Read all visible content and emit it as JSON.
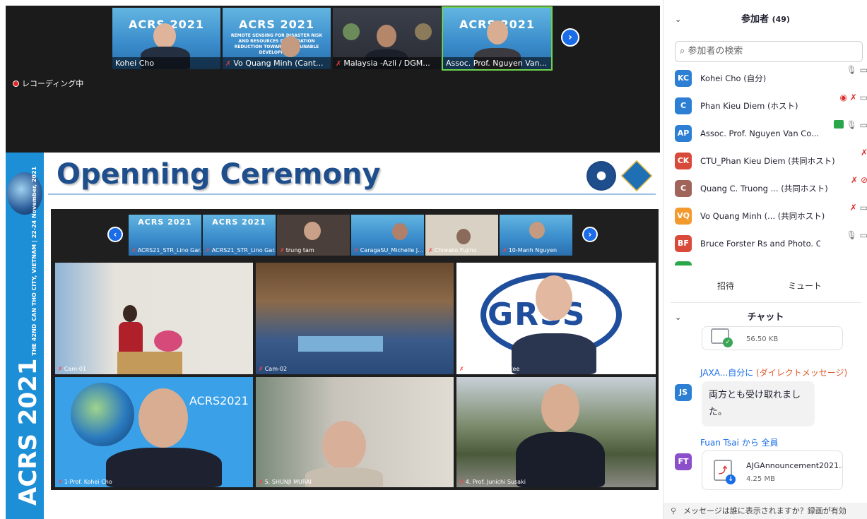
{
  "meeting": {
    "recording_label": "レコーディング中",
    "top_strip": [
      {
        "name": "Kohei Cho",
        "muted": false
      },
      {
        "name": "Vo Quang Minh (Cant...",
        "muted": true
      },
      {
        "name": "Malaysia -Azli / DGM...",
        "muted": true
      },
      {
        "name": "Assoc. Prof. Nguyen Van...",
        "muted": false
      }
    ],
    "acrs_banner": {
      "edition": "THE 42ND",
      "title": "ACRS 2021",
      "subtitle": "REMOTE SENSING FOR DISASTER RISK AND RESOURCES DEGRADATION REDUCTION TOWARD SUSTAINABLE DEVELOPMENT"
    },
    "next_icon": "chevron-right-icon",
    "prev_icon": "chevron-left-icon"
  },
  "slide": {
    "title": "Openning Ceremony",
    "side_title": "ACRS 2021",
    "side_edition": "THE 42ND",
    "side_subtitle": "CAN THO CITY, VIETNAM | 22-24 November, 2021",
    "inner_strip": [
      "ACRS21_STR_Lino Gar...",
      "ACRS21_STR_Lino Gar...",
      "trung tam",
      "CaragaSU_Michelle J...",
      "Chiwako Fujino",
      "10-Manh Nguyen"
    ],
    "grid": [
      "Cam-01",
      "Cam-02",
      "2-Dr. David Kunkee",
      "1-Prof. Kohei Cho",
      "5. SHUNJI MURAI",
      "4. Prof. Junichi Susaki"
    ],
    "grss_text": "GRSS",
    "acrs_tag": "ACRS2021"
  },
  "participants": {
    "header": "参加者",
    "count": "(49)",
    "search_placeholder": "参加者の検索",
    "list": [
      {
        "initials": "KC",
        "name": "Kohei Cho (自分)",
        "color": "#2d7fd3",
        "icons": "🎙 ▭"
      },
      {
        "initials": "C",
        "name": "Phan Kieu Diem (ホスト)",
        "color": "#2d7fd3",
        "icons": "◉ ✗ ▭"
      },
      {
        "initials": "AP",
        "name": "Assoc. Prof. Nguyen Van Co...",
        "color": "#2d7fd3",
        "icons": "🎙 ▭"
      },
      {
        "initials": "CK",
        "name": "CTU_Phan Kieu Diem (共同ホスト)",
        "color": "#d94a3a",
        "icons": "✗"
      },
      {
        "initials": "C",
        "name": "Quang C. Truong ... (共同ホスト)",
        "color": "#a0645a",
        "icons": "✗ ⊘"
      },
      {
        "initials": "VQ",
        "name": "Vo Quang Minh (... (共同ホスト)",
        "color": "#f29a2e",
        "icons": "✗ ▭"
      },
      {
        "initials": "BF",
        "name": "Bruce Forster Rs and Photo. Co...",
        "color": "#d94a3a",
        "icons": "🎙 ▭"
      }
    ],
    "invite_button": "招待",
    "mute_button": "ミュート"
  },
  "chat": {
    "header": "チャット",
    "messages": [
      {
        "type": "file",
        "size": "56.50 KB"
      },
      {
        "from": "JAXA...自分に",
        "dm": "(ダイレクトメッセージ)",
        "initials": "JS",
        "color": "#2d7fd3",
        "text": "両方とも受け取れました。"
      },
      {
        "from": "Fuan Tsai から 全員",
        "initials": "FT",
        "color": "#8a4fc9",
        "file_name": "AJGAnnouncement2021....",
        "size": "4.25 MB"
      }
    ],
    "footer": "メッセージは誰に表示されますか？録画が有効"
  }
}
